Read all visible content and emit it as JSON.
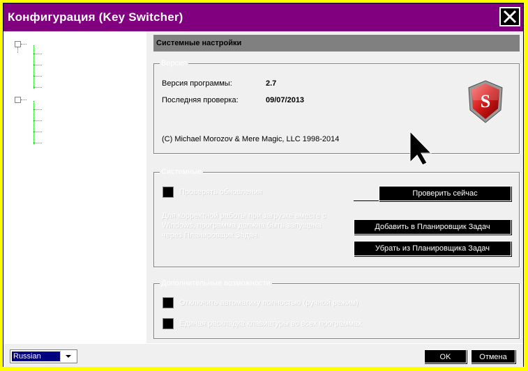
{
  "window": {
    "title": "Конфигурация (Key Switcher)"
  },
  "section": {
    "header": "Системные настройки"
  },
  "version_group": {
    "legend": "Версия",
    "program_version_label": "Версия программы:",
    "program_version_value": "2.7",
    "last_check_label": "Последняя проверка:",
    "last_check_value": "09/07/2013",
    "copyright": "(C) Michael Morozov & Mere Magic, LLC 1998-2014",
    "logo_letter": "S"
  },
  "system_group": {
    "legend": "Системные",
    "check_updates_label": "Проверять обновления",
    "check_now_button": "Проверить сейчас",
    "note": "Для корректной работы при загрузке вместе с Windows, программа должна быть запущена через Планировщик Задач.",
    "add_scheduler_button": "Добавить в Планировщик Задач",
    "remove_scheduler_button": "Убрать из Планировщика Задач"
  },
  "extra_group": {
    "legend": "Дополнительные возможности",
    "disable_auto_label": "Отключить автоматику полностью (ручной режим)",
    "single_layout_label": "Единая раскладка клавиатуры во всех программах"
  },
  "footer": {
    "language_value": "Russian",
    "ok_button": "OK",
    "cancel_button": "Отмена"
  },
  "colors": {
    "outer_border": "#ffff00",
    "titlebar": "#800080",
    "tree_lines": "#00dd00",
    "section_header": "#808080",
    "button_bg": "#000000",
    "selection": "#000080"
  }
}
